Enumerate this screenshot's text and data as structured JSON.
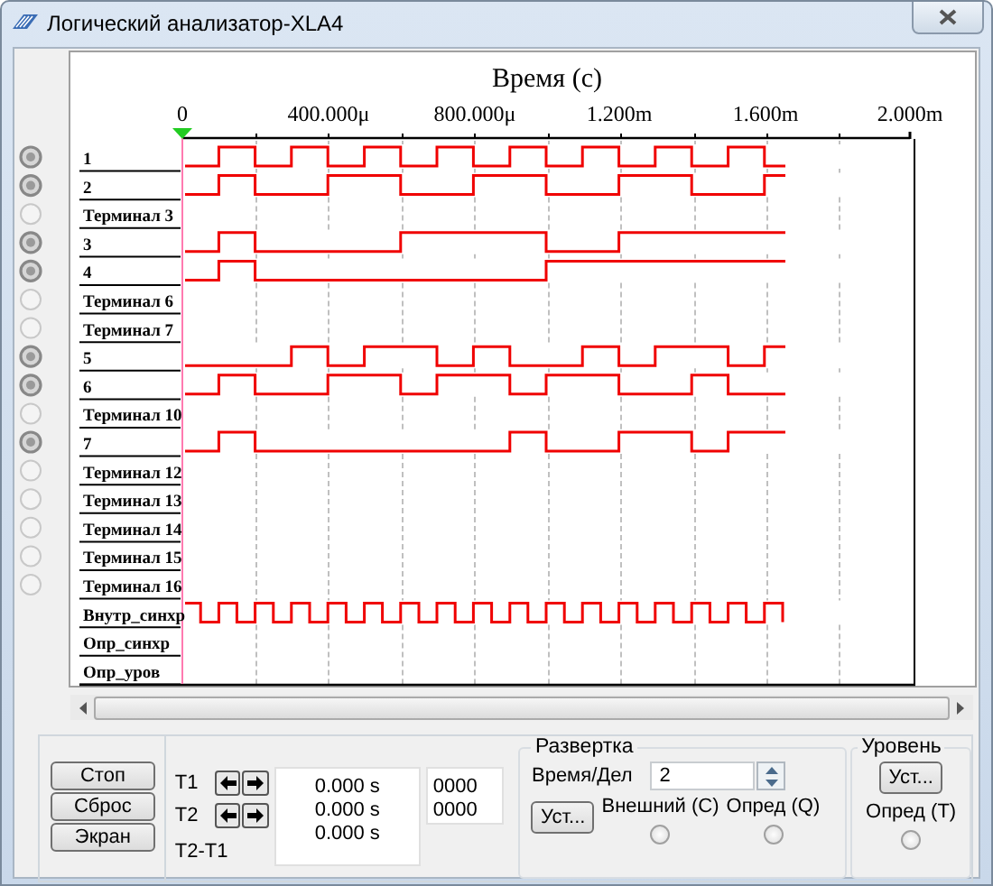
{
  "window": {
    "title": "Логический анализатор-XLA4"
  },
  "display": {
    "axis_title": "Время (с)",
    "time_ticks": [
      "0",
      "400.000μ",
      "800.000μ",
      "1.200m",
      "1.600m",
      "2.000m"
    ],
    "channels": [
      {
        "label": "1",
        "kind": "terminal",
        "active": true
      },
      {
        "label": "2",
        "kind": "terminal",
        "active": true
      },
      {
        "label": "Терминал 3",
        "kind": "terminal",
        "active": false
      },
      {
        "label": "3",
        "kind": "terminal",
        "active": true
      },
      {
        "label": "4",
        "kind": "terminal",
        "active": true
      },
      {
        "label": "Терминал 6",
        "kind": "terminal",
        "active": false
      },
      {
        "label": "Терминал 7",
        "kind": "terminal",
        "active": false
      },
      {
        "label": "5",
        "kind": "terminal",
        "active": true
      },
      {
        "label": "6",
        "kind": "terminal",
        "active": true
      },
      {
        "label": "Терминал 10",
        "kind": "terminal",
        "active": false
      },
      {
        "label": "7",
        "kind": "terminal",
        "active": true
      },
      {
        "label": "Терминал 12",
        "kind": "terminal",
        "active": false
      },
      {
        "label": "Терминал 13",
        "kind": "terminal",
        "active": false
      },
      {
        "label": "Терминал 14",
        "kind": "terminal",
        "active": false
      },
      {
        "label": "Терминал 15",
        "kind": "terminal",
        "active": false
      },
      {
        "label": "Терминал 16",
        "kind": "terminal",
        "active": false
      },
      {
        "label": "Внутр_синхр",
        "kind": "clock"
      },
      {
        "label": "Опр_синхр",
        "kind": "trigger"
      },
      {
        "label": "Опр_уров",
        "kind": "trigger"
      }
    ]
  },
  "controls": {
    "buttons": [
      "Стоп",
      "Сброс",
      "Экран"
    ],
    "cursors": [
      {
        "label": "T1"
      },
      {
        "label": "T2"
      }
    ],
    "difference_label": "T2-T1",
    "times": [
      "0.000 s",
      "0.000 s",
      "0.000 s"
    ],
    "codes": [
      "0000",
      "0000"
    ]
  },
  "sweep": {
    "title": "Развертка",
    "time_per_div_label": "Время/Дел",
    "time_per_div": "2",
    "set_button": "Уст...",
    "options": [
      {
        "label": "Внешний (С)",
        "selected": false
      },
      {
        "label": "Опред (Q)",
        "selected": false
      }
    ]
  },
  "level": {
    "title": "Уровень",
    "set_button": "Уст...",
    "options": [
      {
        "label": "Опред (Т)",
        "selected": false
      }
    ]
  }
}
